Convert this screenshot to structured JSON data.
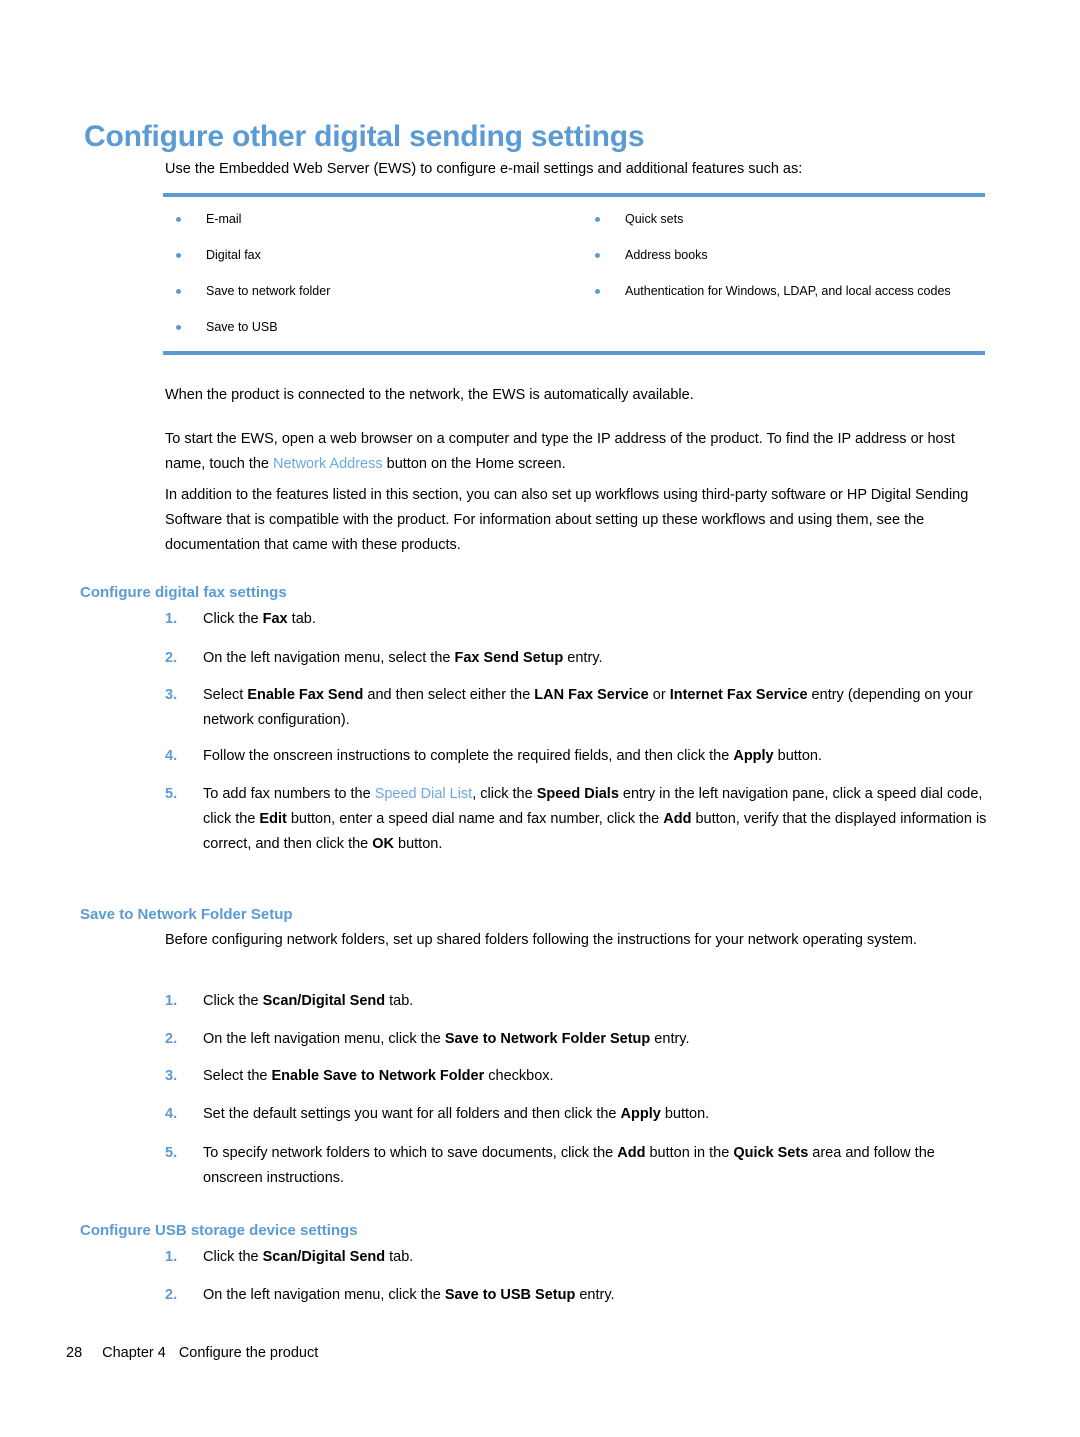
{
  "document": {
    "title": "Configure other digital sending settings",
    "intro": "Use the Embedded Web Server (EWS) to configure e-mail settings and additional features such as:"
  },
  "feature_table": {
    "left_column": [
      "E-mail",
      "Digital fax",
      "Save to network folder",
      "Save to USB"
    ],
    "right_column": [
      "Quick sets",
      "Address books",
      "Authentication for Windows, LDAP, and local access codes"
    ]
  },
  "paragraphs": {
    "p1": "When the product is connected to the network, the EWS is automatically available.",
    "p2_before": "To start the EWS, open a web browser on a computer and type the IP address of the product. To find the IP address or host name, touch the ",
    "p2_link": "Network Address",
    "p2_after": " button on the Home screen.",
    "p3": "In addition to the features listed in this section, you can also set up workflows using third-party software or HP Digital Sending Software that is compatible with the product. For information about setting up these workflows and using them, see the documentation that came with these products."
  },
  "sections": {
    "fax": {
      "heading": "Configure digital fax settings",
      "steps": [
        {
          "number": "1.",
          "segments": [
            {
              "text": "Click the ",
              "bold": false
            },
            {
              "text": "Fax",
              "bold": true
            },
            {
              "text": " tab.",
              "bold": false
            }
          ]
        },
        {
          "number": "2.",
          "segments": [
            {
              "text": "On the left navigation menu, select the ",
              "bold": false
            },
            {
              "text": "Fax Send Setup",
              "bold": true
            },
            {
              "text": " entry.",
              "bold": false
            }
          ]
        },
        {
          "number": "3.",
          "segments": [
            {
              "text": "Select ",
              "bold": false
            },
            {
              "text": "Enable Fax Send",
              "bold": true
            },
            {
              "text": " and then select either the ",
              "bold": false
            },
            {
              "text": "LAN Fax Service",
              "bold": true
            },
            {
              "text": " or ",
              "bold": false
            },
            {
              "text": "Internet Fax Service",
              "bold": true
            },
            {
              "text": " entry (depending on your network configuration).",
              "bold": false
            }
          ]
        },
        {
          "number": "4.",
          "segments": [
            {
              "text": "Follow the onscreen instructions to complete the required fields, and then click the ",
              "bold": false
            },
            {
              "text": "Apply",
              "bold": true
            },
            {
              "text": " button.",
              "bold": false
            }
          ]
        },
        {
          "number": "5.",
          "segments": [
            {
              "text": "To add fax numbers to the ",
              "bold": false
            },
            {
              "text": "Speed Dial List",
              "bold": false,
              "link": true
            },
            {
              "text": ", click the ",
              "bold": false
            },
            {
              "text": "Speed Dials",
              "bold": true
            },
            {
              "text": " entry in the left navigation pane, click a speed dial code, click the ",
              "bold": false
            },
            {
              "text": "Edit",
              "bold": true
            },
            {
              "text": " button, enter a speed dial name and fax number, click the ",
              "bold": false
            },
            {
              "text": "Add",
              "bold": true
            },
            {
              "text": " button, verify that the displayed information is correct, and then click the ",
              "bold": false
            },
            {
              "text": "OK",
              "bold": true
            },
            {
              "text": " button.",
              "bold": false
            }
          ]
        }
      ]
    },
    "network_folder": {
      "heading": "Save to Network Folder Setup",
      "intro": "Before configuring network folders, set up shared folders following the instructions for your network operating system.",
      "steps": [
        {
          "number": "1.",
          "segments": [
            {
              "text": "Click the ",
              "bold": false
            },
            {
              "text": "Scan/Digital Send",
              "bold": true
            },
            {
              "text": " tab.",
              "bold": false
            }
          ]
        },
        {
          "number": "2.",
          "segments": [
            {
              "text": "On the left navigation menu, click the ",
              "bold": false
            },
            {
              "text": "Save to Network Folder Setup",
              "bold": true
            },
            {
              "text": " entry.",
              "bold": false
            }
          ]
        },
        {
          "number": "3.",
          "segments": [
            {
              "text": "Select the ",
              "bold": false
            },
            {
              "text": "Enable Save to Network Folder",
              "bold": true
            },
            {
              "text": " checkbox.",
              "bold": false
            }
          ]
        },
        {
          "number": "4.",
          "segments": [
            {
              "text": "Set the default settings you want for all folders and then click the ",
              "bold": false
            },
            {
              "text": "Apply",
              "bold": true
            },
            {
              "text": " button.",
              "bold": false
            }
          ]
        },
        {
          "number": "5.",
          "segments": [
            {
              "text": "To specify network folders to which to save documents, click the ",
              "bold": false
            },
            {
              "text": "Add",
              "bold": true
            },
            {
              "text": " button in the ",
              "bold": false
            },
            {
              "text": "Quick Sets",
              "bold": true
            },
            {
              "text": " area and follow the onscreen instructions.",
              "bold": false
            }
          ]
        }
      ]
    },
    "usb": {
      "heading": "Configure USB storage device settings",
      "steps": [
        {
          "number": "1.",
          "segments": [
            {
              "text": "Click the ",
              "bold": false
            },
            {
              "text": "Scan/Digital Send",
              "bold": true
            },
            {
              "text": " tab.",
              "bold": false
            }
          ]
        },
        {
          "number": "2.",
          "segments": [
            {
              "text": "On the left navigation menu, click the ",
              "bold": false
            },
            {
              "text": "Save to USB Setup",
              "bold": true
            },
            {
              "text": " entry.",
              "bold": false
            }
          ]
        }
      ]
    }
  },
  "footer": {
    "page_number": "28",
    "chapter": "Chapter 4",
    "chapter_title": "Configure the product"
  },
  "colors": {
    "accent_blue": "#5b9bd5",
    "link_blue": "#6aa9e0",
    "text_black": "#000000"
  }
}
